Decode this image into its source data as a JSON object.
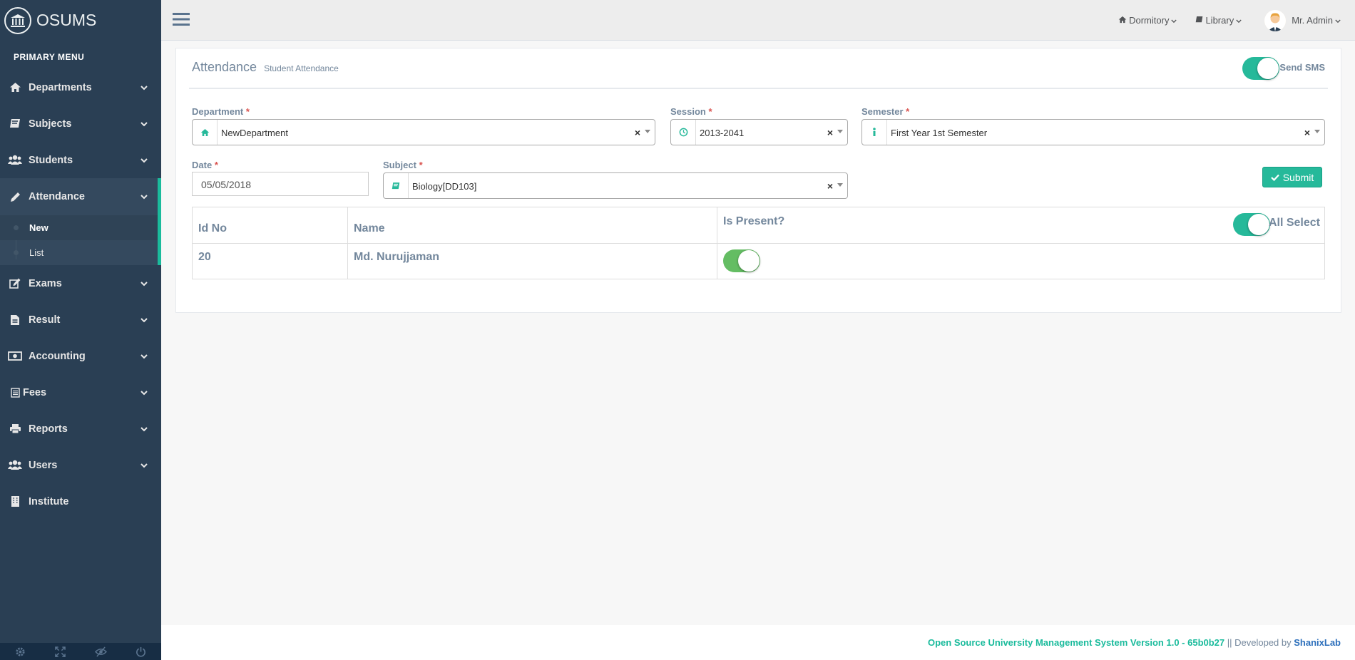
{
  "brand": {
    "name": "OSUMS"
  },
  "menu": {
    "title": "PRIMARY MENU",
    "items": [
      {
        "label": "Departments",
        "icon": "home-icon"
      },
      {
        "label": "Subjects",
        "icon": "book-icon"
      },
      {
        "label": "Students",
        "icon": "users-icon"
      },
      {
        "label": "Attendance",
        "icon": "pencil-icon",
        "sub": [
          "New",
          "List"
        ]
      },
      {
        "label": "Exams",
        "icon": "edit-icon"
      },
      {
        "label": "Result",
        "icon": "file-icon"
      },
      {
        "label": "Accounting",
        "icon": "money-icon"
      },
      {
        "label": "Fees",
        "icon": "list-icon"
      },
      {
        "label": "Reports",
        "icon": "print-icon"
      },
      {
        "label": "Users",
        "icon": "users-icon"
      },
      {
        "label": "Institute",
        "icon": "building-icon"
      }
    ]
  },
  "topnav": {
    "dormitory": "Dormitory",
    "library": "Library",
    "user": "Mr. Admin"
  },
  "page": {
    "title": "Attendance",
    "subtitle": "Student Attendance",
    "send_sms": "Send SMS"
  },
  "form": {
    "department": {
      "label": "Department",
      "value": "NewDepartment"
    },
    "session": {
      "label": "Session",
      "value": "2013-2041"
    },
    "semester": {
      "label": "Semester",
      "value": "First Year 1st Semester"
    },
    "date": {
      "label": "Date",
      "value": "05/05/2018"
    },
    "subject": {
      "label": "Subject",
      "value": "Biology[DD103]"
    },
    "required_mark": "*",
    "submit": "Submit",
    "clear_mark": "×"
  },
  "table": {
    "headers": {
      "id": "Id No",
      "name": "Name",
      "present": "Is Present?",
      "all_select": "All Select"
    },
    "rows": [
      {
        "id": "20",
        "name": "Md. Nurujjaman",
        "present": true
      }
    ]
  },
  "footer": {
    "system": "Open Source University Management System Version 1.0 - 65b0b27",
    "separator": " || Developed by ",
    "developer": "ShanixLab"
  },
  "colors": {
    "accent": "#26b99a",
    "sidebar": "#2a3f54",
    "toggle_on": "#64bd63",
    "link": "#1abb9c",
    "developer": "#2c6fbb"
  }
}
